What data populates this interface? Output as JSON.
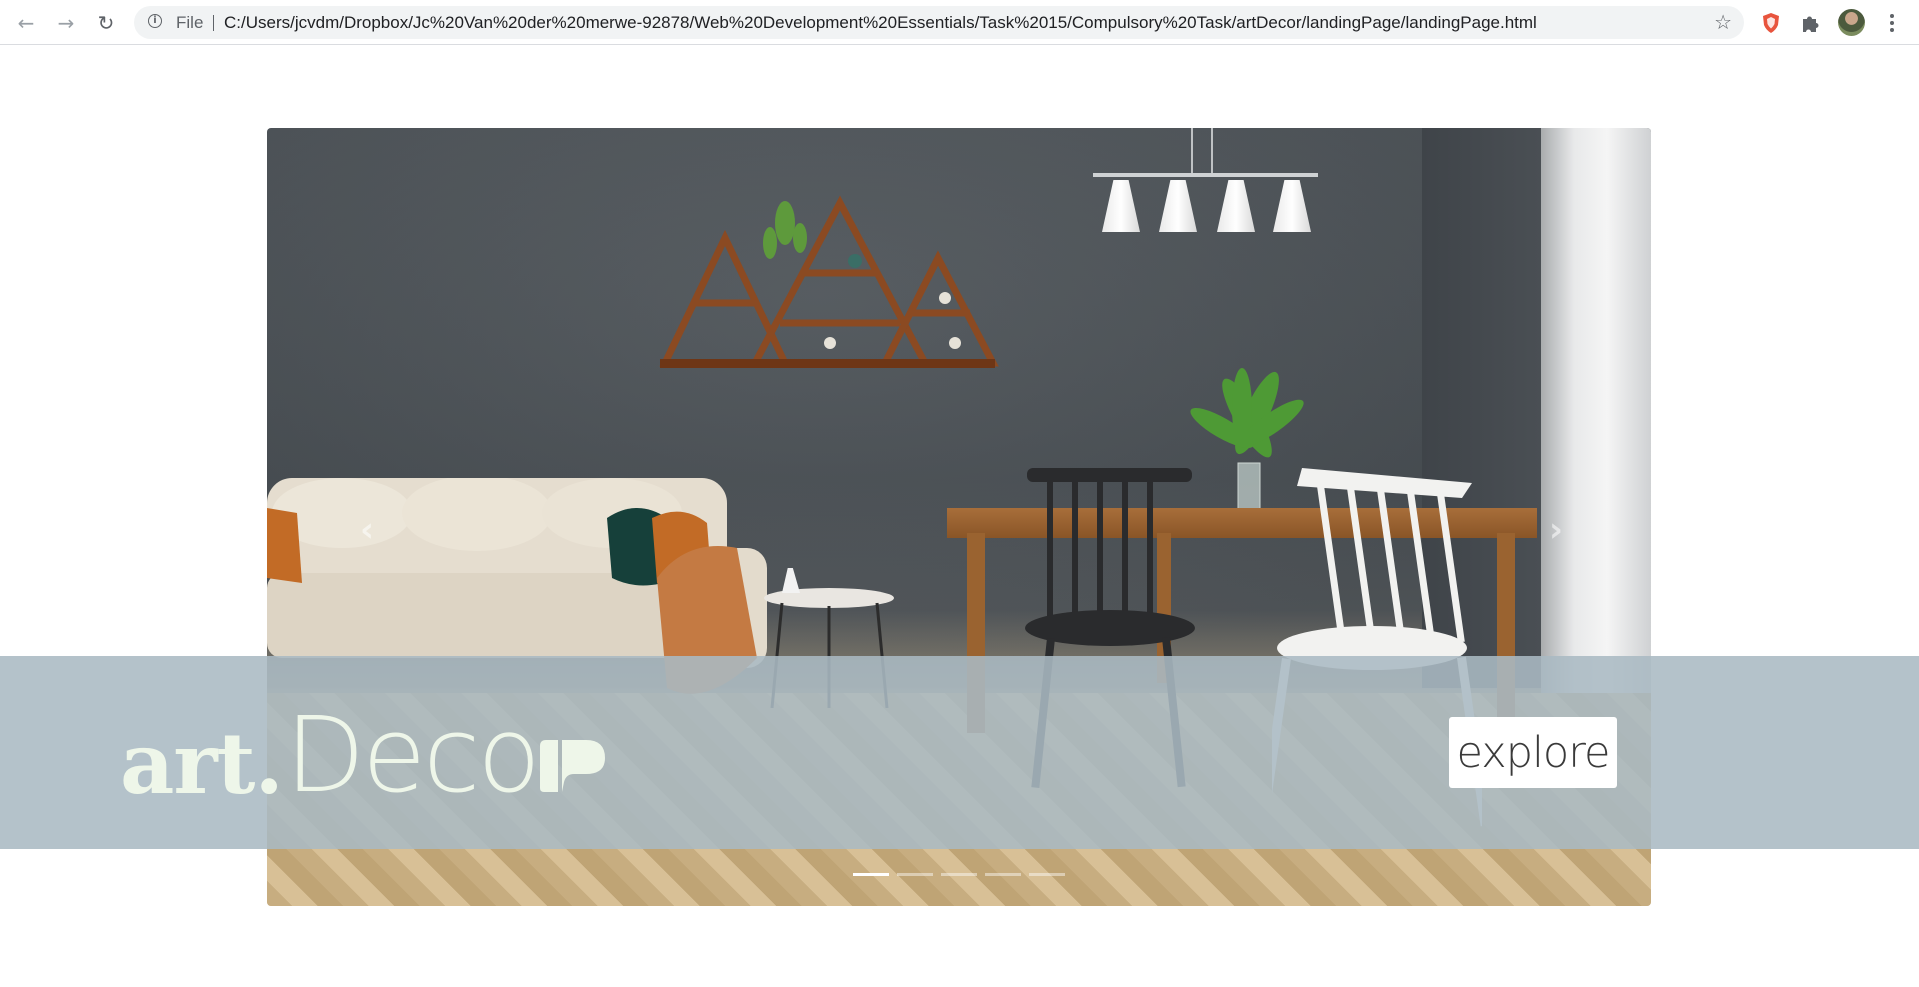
{
  "browser": {
    "back_icon": "arrow-left-icon",
    "forward_icon": "arrow-right-icon",
    "reload_icon": "reload-icon",
    "site_info_icon": "info-icon",
    "scheme_label": "File",
    "url": "C:/Users/jcvdm/Dropbox/Jc%20Van%20der%20merwe-92878/Web%20Development%20Essentials/Task%2015/Compulsory%20Task/artDecor/landingPage/landingPage.html",
    "bookmark_icon": "star-icon",
    "extensions": [
      "shield-extension-icon",
      "puzzle-extensions-icon"
    ],
    "profile_icon": "avatar",
    "menu_icon": "more-vert-icon"
  },
  "carousel": {
    "image_description_icon": "living-room-photo",
    "prev_icon": "chevron-left-icon",
    "next_icon": "chevron-right-icon",
    "indicators": [
      true,
      false,
      false,
      false,
      false
    ]
  },
  "banner": {
    "logo_part1": "art.",
    "logo_part2": "Deco",
    "explore_label": "explore",
    "colors": {
      "banner_overlay": "#aab9c3",
      "logo_text": "#eef6e9",
      "button_bg": "#ffffff"
    }
  }
}
